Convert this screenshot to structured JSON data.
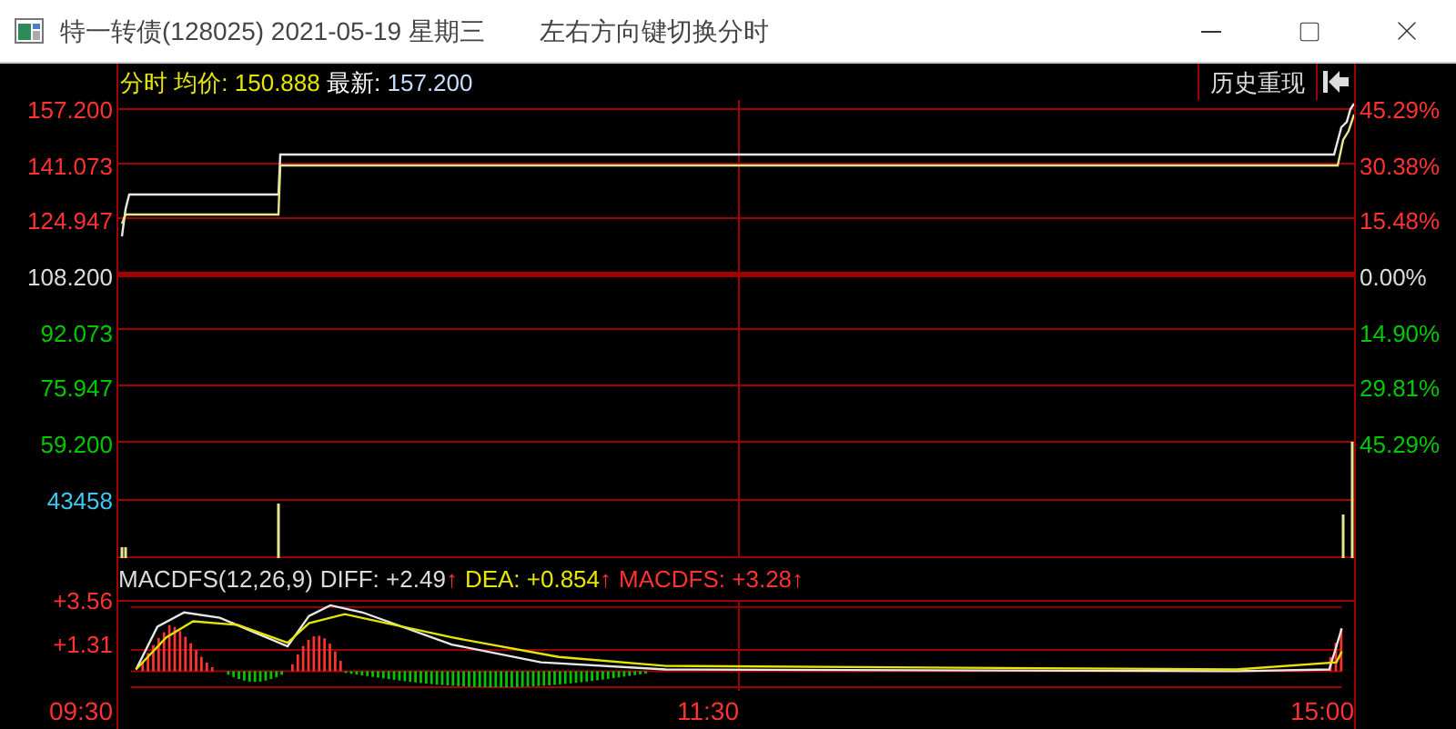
{
  "window": {
    "title": "特一转债(128025) 2021-05-19 星期三",
    "hint": "左右方向键切换分时"
  },
  "chart_header": {
    "mode": "分时",
    "avg_label": "均价:",
    "avg_value": "150.888",
    "last_label": "最新:",
    "last_value": "157.200"
  },
  "history_button": "历史重现",
  "price_axis_left": [
    {
      "label": "157.200",
      "kind": "up"
    },
    {
      "label": "141.073",
      "kind": "up"
    },
    {
      "label": "124.947",
      "kind": "up"
    },
    {
      "label": "108.200",
      "kind": "flat"
    },
    {
      "label": "92.073",
      "kind": "down"
    },
    {
      "label": "75.947",
      "kind": "down"
    },
    {
      "label": "59.200",
      "kind": "down"
    },
    {
      "label": "43458",
      "kind": "volume"
    }
  ],
  "price_axis_right": [
    {
      "label": "45.29%",
      "kind": "up"
    },
    {
      "label": "30.38%",
      "kind": "up"
    },
    {
      "label": "15.48%",
      "kind": "up"
    },
    {
      "label": "0.00%",
      "kind": "flat"
    },
    {
      "label": "14.90%",
      "kind": "down"
    },
    {
      "label": "29.81%",
      "kind": "down"
    },
    {
      "label": "45.29%",
      "kind": "down"
    }
  ],
  "macd_header": [
    {
      "kind": "name",
      "label": "MACDFS(12,26,9)"
    },
    {
      "kind": "diff",
      "label": "DIFF:",
      "value": "+2.49",
      "arrow": "↑"
    },
    {
      "kind": "dea",
      "label": "DEA:",
      "value": "+0.854",
      "arrow": "↑"
    },
    {
      "kind": "macd",
      "label": "MACDFS:",
      "value": "+3.28",
      "arrow": "↑"
    }
  ],
  "macd_axis": [
    "+3.56",
    "+1.31"
  ],
  "time_axis": [
    "09:30",
    "11:30",
    "15:00"
  ]
}
